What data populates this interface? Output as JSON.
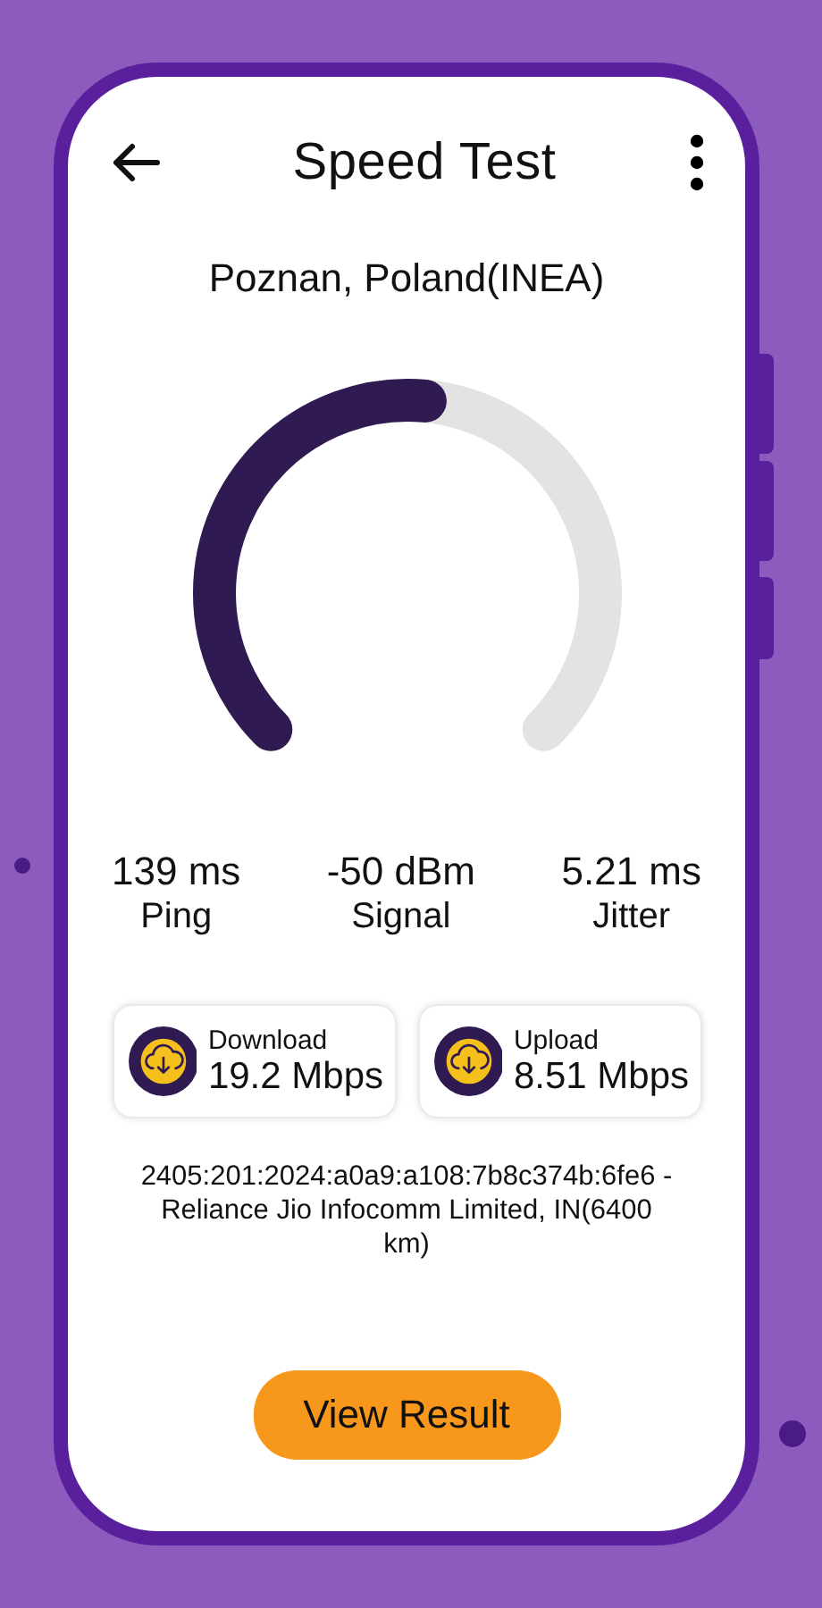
{
  "header": {
    "title": "Speed Test"
  },
  "location": "Poznan, Poland(INEA)",
  "stats": [
    {
      "value": "139 ms",
      "label": "Ping"
    },
    {
      "value": "-50 dBm",
      "label": "Signal"
    },
    {
      "value": "5.21 ms",
      "label": "Jitter"
    }
  ],
  "speeds": [
    {
      "label": "Download",
      "value": "19.2 Mbps"
    },
    {
      "label": "Upload",
      "value": "8.51 Mbps"
    }
  ],
  "server": "2405:201:2024:a0a9:a108:7b8c374b:6fe6 - Reliance Jio Infocomm Limited, IN(6400 km)",
  "action_button": "View Result"
}
